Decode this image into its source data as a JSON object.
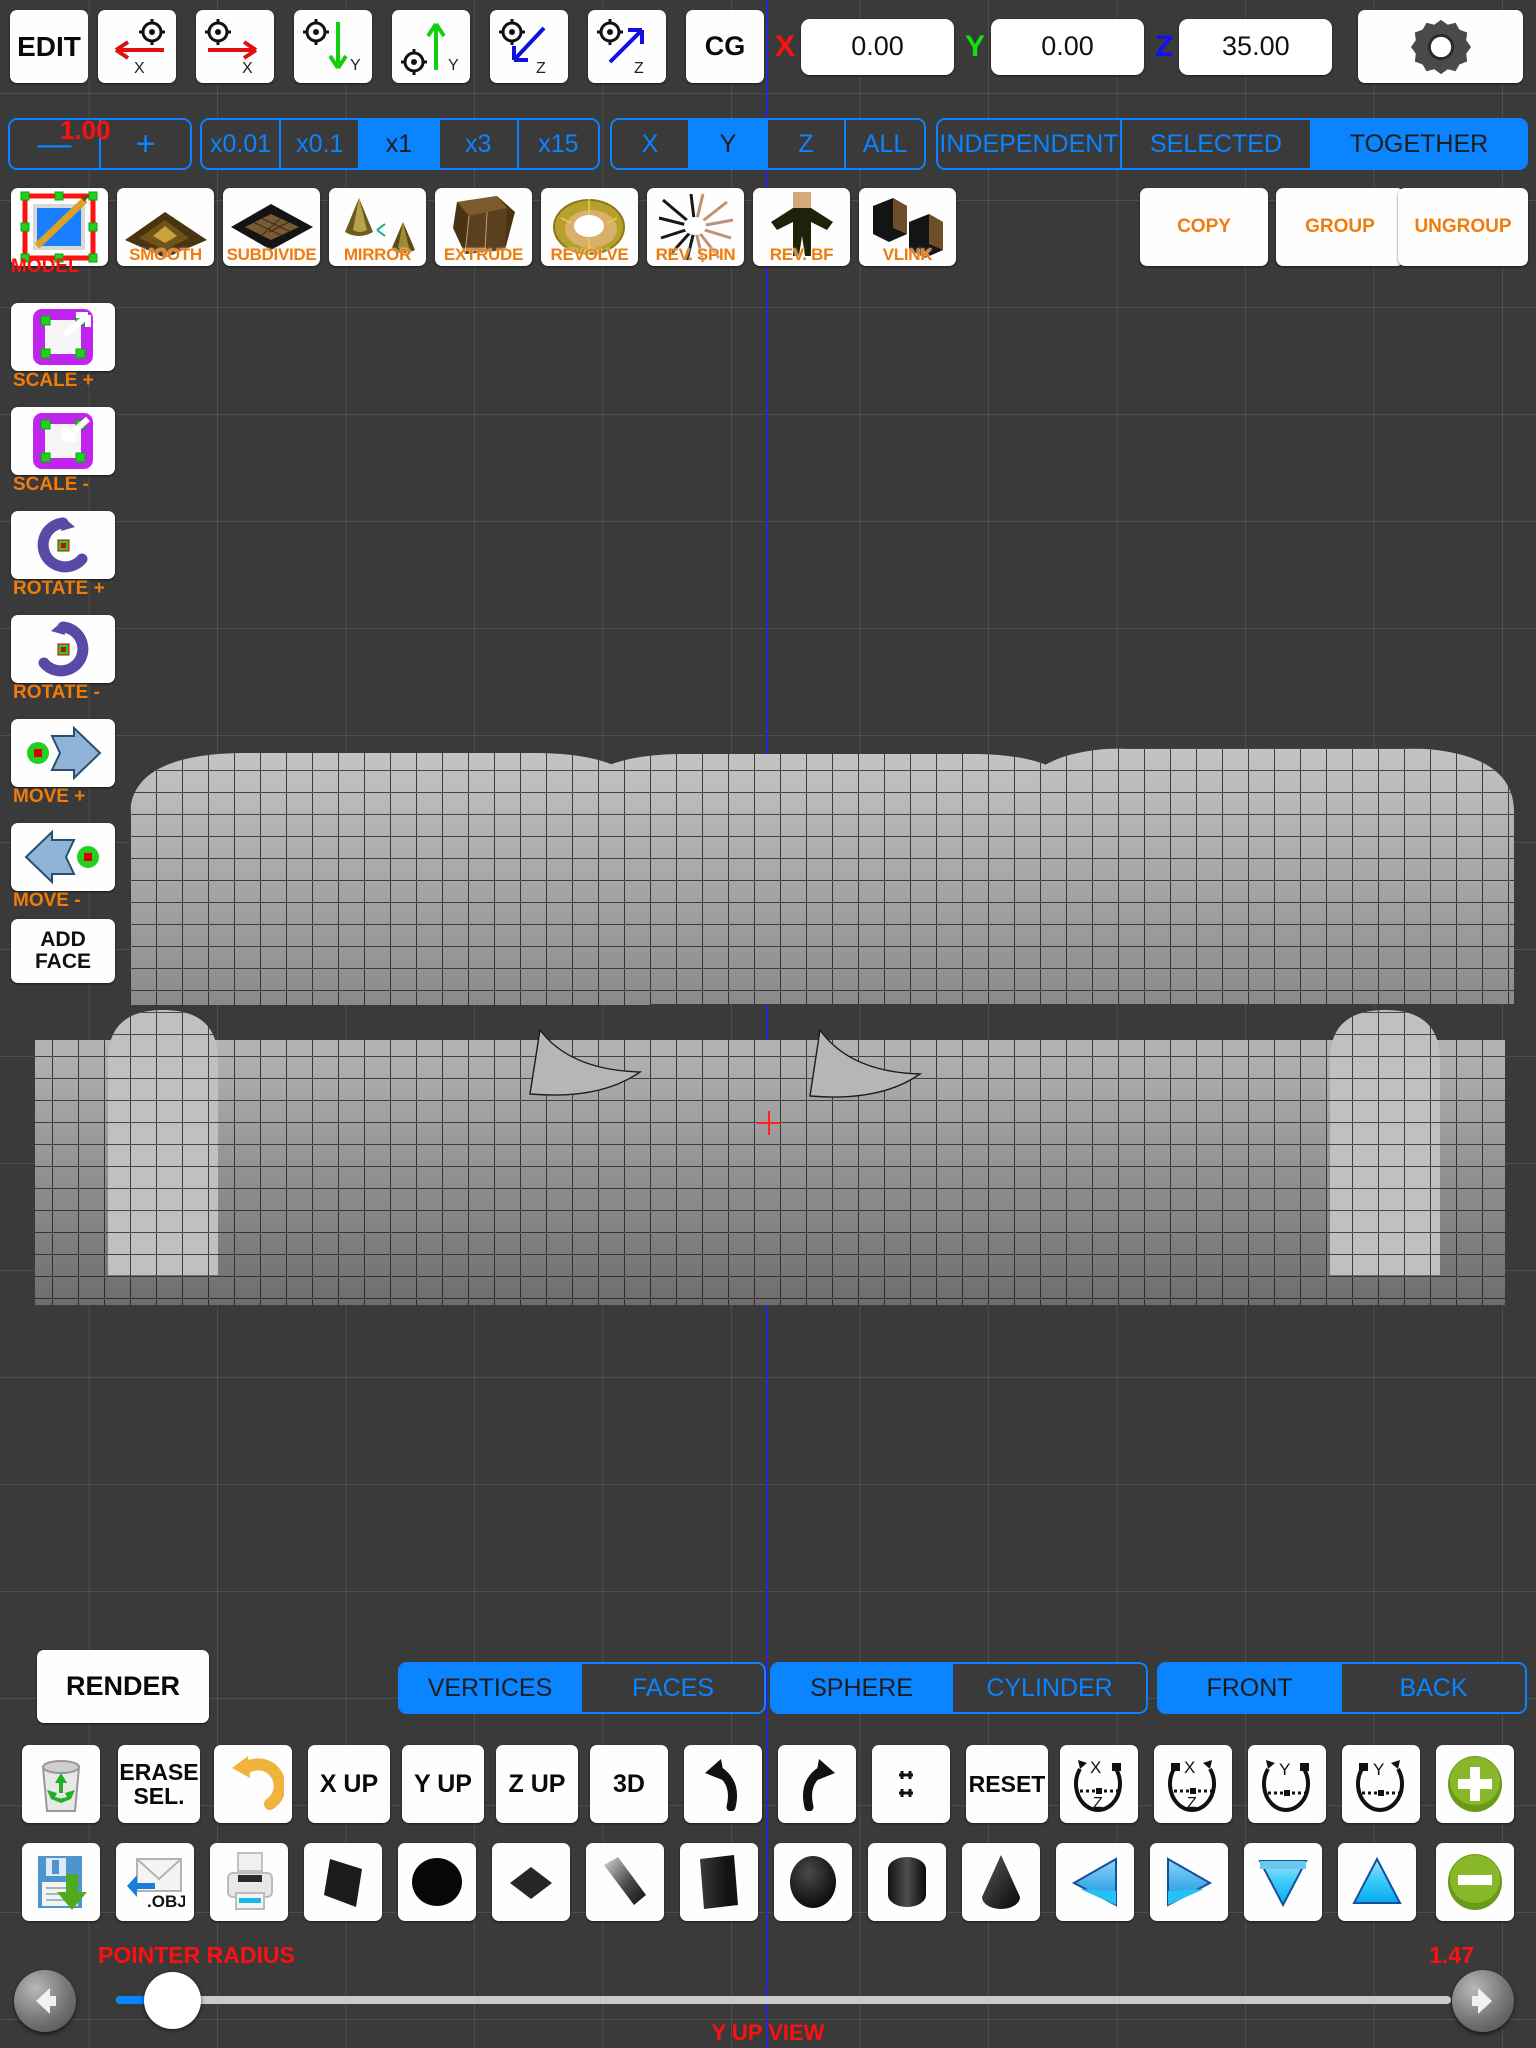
{
  "app": {
    "accent_blue": "#0a84ff",
    "orange": "#f07c0c",
    "red": "#ff1010",
    "bg": "#3a3a3a"
  },
  "toolbar_top": {
    "edit_label": "EDIT",
    "cg_label": "CG",
    "axis_buttons": [
      {
        "name": "move-minus-x",
        "axis": "X",
        "dir": "left",
        "color": "#e01010"
      },
      {
        "name": "move-plus-x",
        "axis": "X",
        "dir": "right",
        "color": "#e01010"
      },
      {
        "name": "move-minus-y",
        "axis": "Y",
        "dir": "down",
        "color": "#10d010"
      },
      {
        "name": "move-plus-y",
        "axis": "Y",
        "dir": "up",
        "color": "#10d010"
      },
      {
        "name": "move-minus-z",
        "axis": "Z",
        "dir": "downleft",
        "color": "#1010e0"
      },
      {
        "name": "move-plus-z",
        "axis": "Z",
        "dir": "upright",
        "color": "#1010e0"
      }
    ],
    "coords": [
      {
        "label": "X",
        "color": "#ff1010",
        "value": "0.00"
      },
      {
        "label": "Y",
        "color": "#10e010",
        "value": "0.00"
      },
      {
        "label": "Z",
        "color": "#1010ff",
        "value": "35.00"
      }
    ],
    "gear_icon": "gear-icon"
  },
  "toolbar_step": {
    "minus_label": "—",
    "plus_label": "+",
    "step_value": "1.00",
    "multipliers": {
      "options": [
        "x0.01",
        "x0.1",
        "x1",
        "x3",
        "x15"
      ],
      "selected": "x1"
    },
    "axes": {
      "options": [
        "X",
        "Y",
        "Z",
        "ALL"
      ],
      "selected": "Y"
    },
    "modes": {
      "options": [
        "INDEPENDENT",
        "SELECTED",
        "TOGETHER"
      ],
      "selected": "TOGETHER"
    }
  },
  "toolbar_ops": [
    {
      "name": "model-tool",
      "label": "MODEL",
      "label_color": "#ff1010",
      "label_outside": true,
      "icon": "pencil-square-icon"
    },
    {
      "name": "smooth-tool",
      "label": "SMOOTH",
      "icon": "terrain-icon"
    },
    {
      "name": "subdivide-tool",
      "label": "SUBDIVIDE",
      "icon": "plane-grid-icon"
    },
    {
      "name": "mirror-tool",
      "label": "MIRROR",
      "icon": "two-cones-icon"
    },
    {
      "name": "extrude-tool",
      "label": "EXTRUDE",
      "icon": "extruded-block-icon"
    },
    {
      "name": "revolve-tool",
      "label": "REVOLVE",
      "icon": "torus-icon"
    },
    {
      "name": "rev-spin-tool",
      "label": "REV. SPIN",
      "icon": "spin-burst-icon"
    },
    {
      "name": "rev-bf-tool",
      "label": "REV. BF",
      "icon": "figure-icon"
    },
    {
      "name": "vlink-tool",
      "label": "VLINK",
      "icon": "two-cubes-icon"
    },
    {
      "name": "copy-button",
      "label": "COPY",
      "icon": "text-only"
    },
    {
      "name": "group-button",
      "label": "GROUP",
      "icon": "text-only"
    },
    {
      "name": "ungroup-button",
      "label": "UNGROUP",
      "icon": "text-only"
    }
  ],
  "sidebar": [
    {
      "name": "scale-plus",
      "label": "SCALE +",
      "icon": "scale-up-icon"
    },
    {
      "name": "scale-minus",
      "label": "SCALE -",
      "icon": "scale-down-icon"
    },
    {
      "name": "rotate-plus",
      "label": "ROTATE +",
      "icon": "rotate-ccw-icon"
    },
    {
      "name": "rotate-minus",
      "label": "ROTATE -",
      "icon": "rotate-cw-icon"
    },
    {
      "name": "move-plus",
      "label": "MOVE +",
      "icon": "arrow-right-icon"
    },
    {
      "name": "move-minus",
      "label": "MOVE -",
      "icon": "arrow-left-icon"
    },
    {
      "name": "add-face",
      "label": "ADD FACE",
      "icon": "text-only"
    }
  ],
  "bottom": {
    "render_label": "RENDER",
    "selection_mode": {
      "options": [
        "VERTICES",
        "FACES"
      ],
      "selected": "VERTICES"
    },
    "primitive_mode": {
      "options": [
        "SPHERE",
        "CYLINDER"
      ],
      "selected": "SPHERE"
    },
    "facing_mode": {
      "options": [
        "FRONT",
        "BACK"
      ],
      "selected": "FRONT"
    },
    "icons_row1": [
      {
        "name": "trash-icon",
        "label": "",
        "icon": "recycle-bin-icon"
      },
      {
        "name": "erase-selected-button",
        "label": "ERASE\nSEL.",
        "icon": "text-only"
      },
      {
        "name": "undo-arrow-icon",
        "label": "",
        "icon": "undo-orange-icon"
      },
      {
        "name": "x-up-button",
        "label": "X UP",
        "icon": "text-only"
      },
      {
        "name": "y-up-button",
        "label": "Y UP",
        "icon": "text-only"
      },
      {
        "name": "z-up-button",
        "label": "Z UP",
        "icon": "text-only"
      },
      {
        "name": "view-3d-button",
        "label": "3D",
        "icon": "text-only"
      },
      {
        "name": "undo-button",
        "label": "",
        "icon": "undo-black-icon"
      },
      {
        "name": "redo-button",
        "label": "",
        "icon": "redo-black-icon"
      },
      {
        "name": "expand-button",
        "label": "",
        "icon": "four-dots-icon"
      },
      {
        "name": "reset-button",
        "label": "RESET",
        "icon": "text-only"
      },
      {
        "name": "rotate-xz-ccw-button",
        "label": "",
        "icon": "rot-xz-ccw-icon"
      },
      {
        "name": "rotate-xz-cw-button",
        "label": "",
        "icon": "rot-xz-cw-icon"
      },
      {
        "name": "rotate-y-ccw-button",
        "label": "",
        "icon": "rot-y-ccw-icon"
      },
      {
        "name": "rotate-y-cw-button",
        "label": "",
        "icon": "rot-y-cw-icon"
      },
      {
        "name": "zoom-in-button",
        "label": "",
        "icon": "green-plus-icon"
      }
    ],
    "icons_row2": [
      {
        "name": "save-button",
        "label": "",
        "icon": "floppy-save-icon"
      },
      {
        "name": "import-obj-button",
        "label": ".OBJ",
        "icon": "envelope-obj-icon"
      },
      {
        "name": "print-button",
        "label": "",
        "icon": "printer-icon"
      },
      {
        "name": "add-plane-button",
        "label": "",
        "icon": "plane-shape-icon"
      },
      {
        "name": "add-disc-button",
        "label": "",
        "icon": "disc-shape-icon"
      },
      {
        "name": "add-diamond-button",
        "label": "",
        "icon": "diamond-shape-icon"
      },
      {
        "name": "add-bar-button",
        "label": "",
        "icon": "bar-shape-icon"
      },
      {
        "name": "add-cube-button",
        "label": "",
        "icon": "cube-shape-icon"
      },
      {
        "name": "add-sphere-button",
        "label": "",
        "icon": "sphere-shape-icon"
      },
      {
        "name": "add-cylinder-button",
        "label": "",
        "icon": "cylinder-shape-icon"
      },
      {
        "name": "add-cone-button",
        "label": "",
        "icon": "cone-shape-icon"
      },
      {
        "name": "arrow-left-blue-button",
        "label": "",
        "icon": "blue-arrow-left-icon"
      },
      {
        "name": "arrow-right-blue-button",
        "label": "",
        "icon": "blue-arrow-right-icon"
      },
      {
        "name": "arrow-down-blue-button",
        "label": "",
        "icon": "blue-arrow-down-icon"
      },
      {
        "name": "arrow-up-blue-button",
        "label": "",
        "icon": "blue-arrow-up-icon"
      },
      {
        "name": "zoom-out-button",
        "label": "",
        "icon": "green-minus-icon"
      }
    ]
  },
  "slider": {
    "label": "POINTER RADIUS",
    "value": "1.47",
    "percent": 3,
    "prev_icon": "arrow-left-icon",
    "next_icon": "arrow-right-icon"
  },
  "viewport": {
    "view_label": "Y UP VIEW",
    "model": "sofa-wireframe",
    "wire_color": "#ff2020",
    "mesh_color": "#9a9a9a"
  }
}
